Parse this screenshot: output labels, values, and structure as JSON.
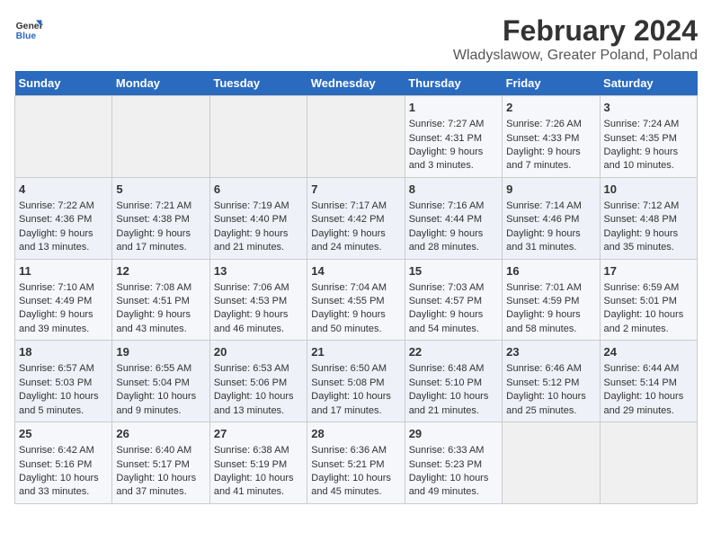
{
  "header": {
    "logo_line1": "General",
    "logo_line2": "Blue",
    "title": "February 2024",
    "subtitle": "Wladyslawow, Greater Poland, Poland"
  },
  "weekdays": [
    "Sunday",
    "Monday",
    "Tuesday",
    "Wednesday",
    "Thursday",
    "Friday",
    "Saturday"
  ],
  "weeks": [
    [
      {
        "day": "",
        "content": ""
      },
      {
        "day": "",
        "content": ""
      },
      {
        "day": "",
        "content": ""
      },
      {
        "day": "",
        "content": ""
      },
      {
        "day": "1",
        "content": "Sunrise: 7:27 AM\nSunset: 4:31 PM\nDaylight: 9 hours\nand 3 minutes."
      },
      {
        "day": "2",
        "content": "Sunrise: 7:26 AM\nSunset: 4:33 PM\nDaylight: 9 hours\nand 7 minutes."
      },
      {
        "day": "3",
        "content": "Sunrise: 7:24 AM\nSunset: 4:35 PM\nDaylight: 9 hours\nand 10 minutes."
      }
    ],
    [
      {
        "day": "4",
        "content": "Sunrise: 7:22 AM\nSunset: 4:36 PM\nDaylight: 9 hours\nand 13 minutes."
      },
      {
        "day": "5",
        "content": "Sunrise: 7:21 AM\nSunset: 4:38 PM\nDaylight: 9 hours\nand 17 minutes."
      },
      {
        "day": "6",
        "content": "Sunrise: 7:19 AM\nSunset: 4:40 PM\nDaylight: 9 hours\nand 21 minutes."
      },
      {
        "day": "7",
        "content": "Sunrise: 7:17 AM\nSunset: 4:42 PM\nDaylight: 9 hours\nand 24 minutes."
      },
      {
        "day": "8",
        "content": "Sunrise: 7:16 AM\nSunset: 4:44 PM\nDaylight: 9 hours\nand 28 minutes."
      },
      {
        "day": "9",
        "content": "Sunrise: 7:14 AM\nSunset: 4:46 PM\nDaylight: 9 hours\nand 31 minutes."
      },
      {
        "day": "10",
        "content": "Sunrise: 7:12 AM\nSunset: 4:48 PM\nDaylight: 9 hours\nand 35 minutes."
      }
    ],
    [
      {
        "day": "11",
        "content": "Sunrise: 7:10 AM\nSunset: 4:49 PM\nDaylight: 9 hours\nand 39 minutes."
      },
      {
        "day": "12",
        "content": "Sunrise: 7:08 AM\nSunset: 4:51 PM\nDaylight: 9 hours\nand 43 minutes."
      },
      {
        "day": "13",
        "content": "Sunrise: 7:06 AM\nSunset: 4:53 PM\nDaylight: 9 hours\nand 46 minutes."
      },
      {
        "day": "14",
        "content": "Sunrise: 7:04 AM\nSunset: 4:55 PM\nDaylight: 9 hours\nand 50 minutes."
      },
      {
        "day": "15",
        "content": "Sunrise: 7:03 AM\nSunset: 4:57 PM\nDaylight: 9 hours\nand 54 minutes."
      },
      {
        "day": "16",
        "content": "Sunrise: 7:01 AM\nSunset: 4:59 PM\nDaylight: 9 hours\nand 58 minutes."
      },
      {
        "day": "17",
        "content": "Sunrise: 6:59 AM\nSunset: 5:01 PM\nDaylight: 10 hours\nand 2 minutes."
      }
    ],
    [
      {
        "day": "18",
        "content": "Sunrise: 6:57 AM\nSunset: 5:03 PM\nDaylight: 10 hours\nand 5 minutes."
      },
      {
        "day": "19",
        "content": "Sunrise: 6:55 AM\nSunset: 5:04 PM\nDaylight: 10 hours\nand 9 minutes."
      },
      {
        "day": "20",
        "content": "Sunrise: 6:53 AM\nSunset: 5:06 PM\nDaylight: 10 hours\nand 13 minutes."
      },
      {
        "day": "21",
        "content": "Sunrise: 6:50 AM\nSunset: 5:08 PM\nDaylight: 10 hours\nand 17 minutes."
      },
      {
        "day": "22",
        "content": "Sunrise: 6:48 AM\nSunset: 5:10 PM\nDaylight: 10 hours\nand 21 minutes."
      },
      {
        "day": "23",
        "content": "Sunrise: 6:46 AM\nSunset: 5:12 PM\nDaylight: 10 hours\nand 25 minutes."
      },
      {
        "day": "24",
        "content": "Sunrise: 6:44 AM\nSunset: 5:14 PM\nDaylight: 10 hours\nand 29 minutes."
      }
    ],
    [
      {
        "day": "25",
        "content": "Sunrise: 6:42 AM\nSunset: 5:16 PM\nDaylight: 10 hours\nand 33 minutes."
      },
      {
        "day": "26",
        "content": "Sunrise: 6:40 AM\nSunset: 5:17 PM\nDaylight: 10 hours\nand 37 minutes."
      },
      {
        "day": "27",
        "content": "Sunrise: 6:38 AM\nSunset: 5:19 PM\nDaylight: 10 hours\nand 41 minutes."
      },
      {
        "day": "28",
        "content": "Sunrise: 6:36 AM\nSunset: 5:21 PM\nDaylight: 10 hours\nand 45 minutes."
      },
      {
        "day": "29",
        "content": "Sunrise: 6:33 AM\nSunset: 5:23 PM\nDaylight: 10 hours\nand 49 minutes."
      },
      {
        "day": "",
        "content": ""
      },
      {
        "day": "",
        "content": ""
      }
    ]
  ]
}
